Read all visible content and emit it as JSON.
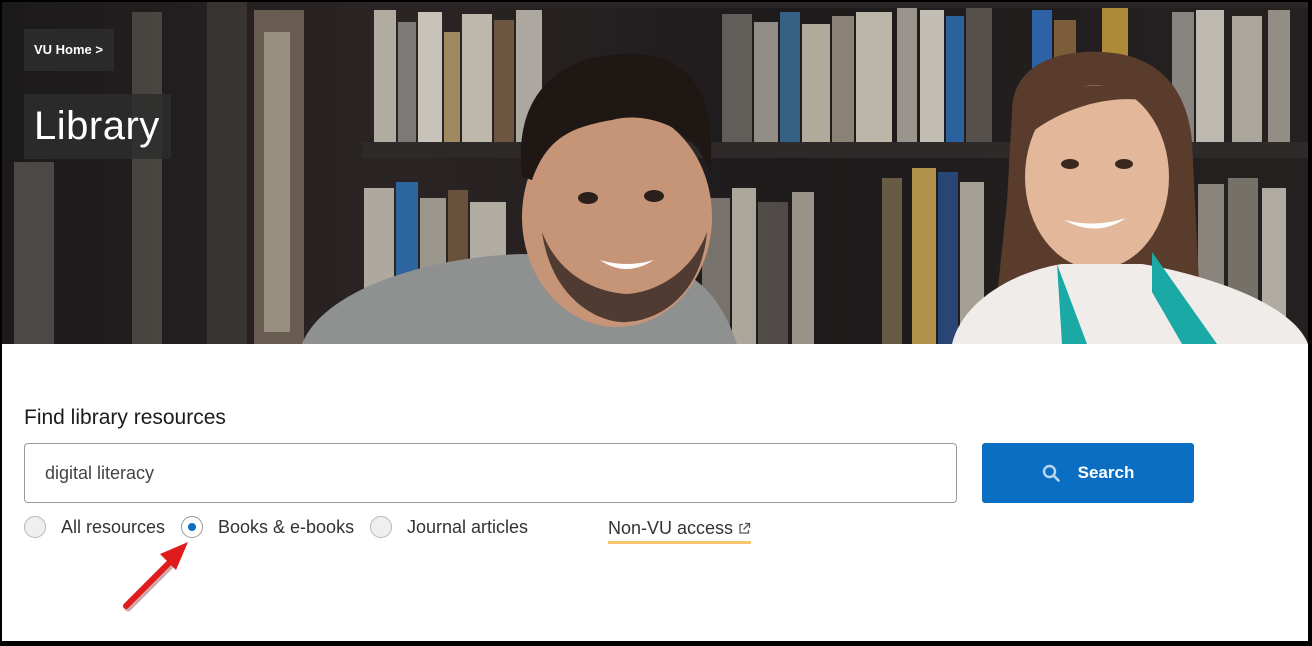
{
  "hero": {
    "breadcrumb": "VU Home >",
    "title": "Library"
  },
  "search": {
    "heading": "Find library resources",
    "query": "digital literacy",
    "button_label": "Search",
    "options": [
      {
        "label": "All resources",
        "selected": false
      },
      {
        "label": "Books & e-books",
        "selected": true
      },
      {
        "label": "Journal articles",
        "selected": false
      }
    ],
    "external_link": "Non-VU access"
  },
  "colors": {
    "accent": "#0a6fc2",
    "link_underline": "#f7c56f",
    "annotation_arrow": "#e01b1b"
  },
  "icons": [
    "search-icon",
    "external-link-icon",
    "annotation-arrow-icon"
  ]
}
